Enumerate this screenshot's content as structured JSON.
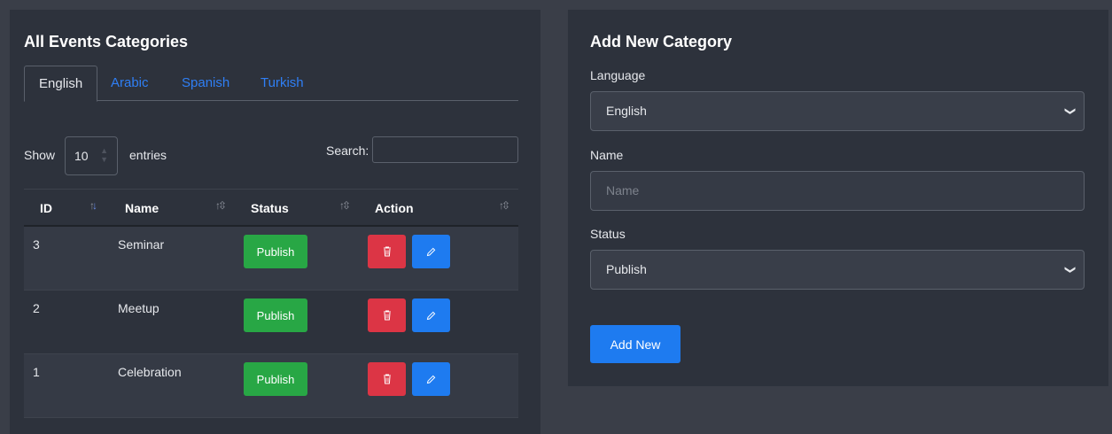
{
  "left": {
    "title": "All Events Categories",
    "tabs": [
      {
        "label": "English",
        "active": true
      },
      {
        "label": "Arabic",
        "active": false
      },
      {
        "label": "Spanish",
        "active": false
      },
      {
        "label": "Turkish",
        "active": false
      }
    ],
    "show_label": "Show",
    "entries_value": "10",
    "entries_label": "entries",
    "search_label": "Search:",
    "search_value": "",
    "columns": [
      "ID",
      "Name",
      "Status",
      "Action"
    ],
    "rows": [
      {
        "id": "3",
        "name": "Seminar",
        "status": "Publish"
      },
      {
        "id": "2",
        "name": "Meetup",
        "status": "Publish"
      },
      {
        "id": "1",
        "name": "Celebration",
        "status": "Publish"
      }
    ]
  },
  "right": {
    "title": "Add New Category",
    "language_label": "Language",
    "language_value": "English",
    "name_label": "Name",
    "name_placeholder": "Name",
    "status_label": "Status",
    "status_value": "Publish",
    "submit_label": "Add New"
  },
  "colors": {
    "page_bg": "#3a3e48",
    "card_bg": "#2d323c",
    "accent_blue": "#1e7bf0",
    "publish_green": "#28a745",
    "delete_red": "#dc3545"
  },
  "icons": [
    "sort-icon",
    "trash-icon",
    "pencil-icon",
    "chevron-down-icon"
  ]
}
